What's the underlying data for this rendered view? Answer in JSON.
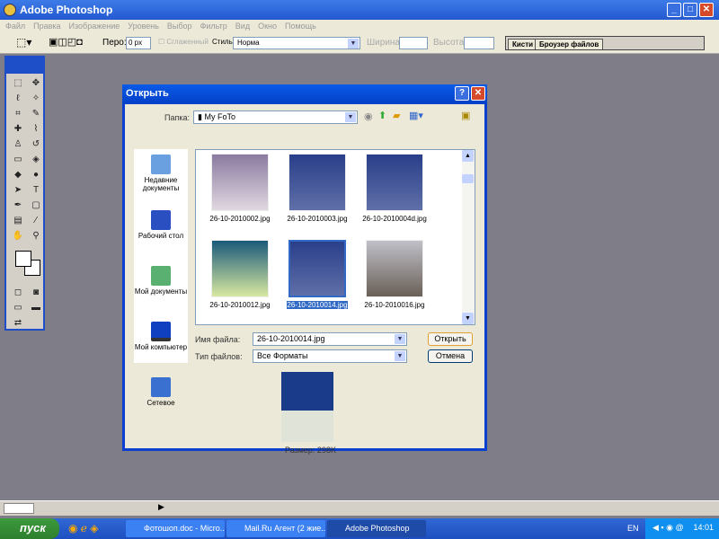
{
  "app": {
    "title": "Adobe Photoshop"
  },
  "menu": [
    "Файл",
    "Правка",
    "Изображение",
    "Уровень",
    "Выбор",
    "Фильтр",
    "Вид",
    "Окно",
    "Помощь"
  ],
  "options": {
    "feather_label": "Перо:",
    "feather_value": "0 px",
    "antialias_label": "Сглаженный",
    "style_label": "Стиль:",
    "style_value": "Норма",
    "width_label": "Ширина:",
    "height_label": "Высота:"
  },
  "palette_tabs": [
    "Кисти",
    "Броузер файлов"
  ],
  "dialog": {
    "title": "Открыть",
    "folder_label": "Папка:",
    "folder_value": "My FoTo",
    "places": [
      "Недавние документы",
      "Рабочий стол",
      "Мой документы",
      "Мой компьютер",
      "Сетевое"
    ],
    "files": [
      {
        "name": "26-10-2010002.jpg",
        "selected": false
      },
      {
        "name": "26-10-2010003.jpg",
        "selected": false
      },
      {
        "name": "26-10-2010004d.jpg",
        "selected": false
      },
      {
        "name": "26-10-2010012.jpg",
        "selected": false
      },
      {
        "name": "26-10-2010014.jpg",
        "selected": true
      },
      {
        "name": "26-10-2010016.jpg",
        "selected": false
      }
    ],
    "filename_label": "Имя файла:",
    "filename_value": "26-10-2010014.jpg",
    "filetype_label": "Тип файлов:",
    "filetype_value": "Все Форматы",
    "open_button": "Открыть",
    "cancel_button": "Отмена",
    "size_text": "Размер: 298K"
  },
  "taskbar": {
    "start": "пуск",
    "tasks": [
      "Фотошоп.doc - Micro...",
      "Mail.Ru Агент (2 жие...",
      "Adobe Photoshop"
    ],
    "lang": "EN",
    "clock": "14:01"
  }
}
